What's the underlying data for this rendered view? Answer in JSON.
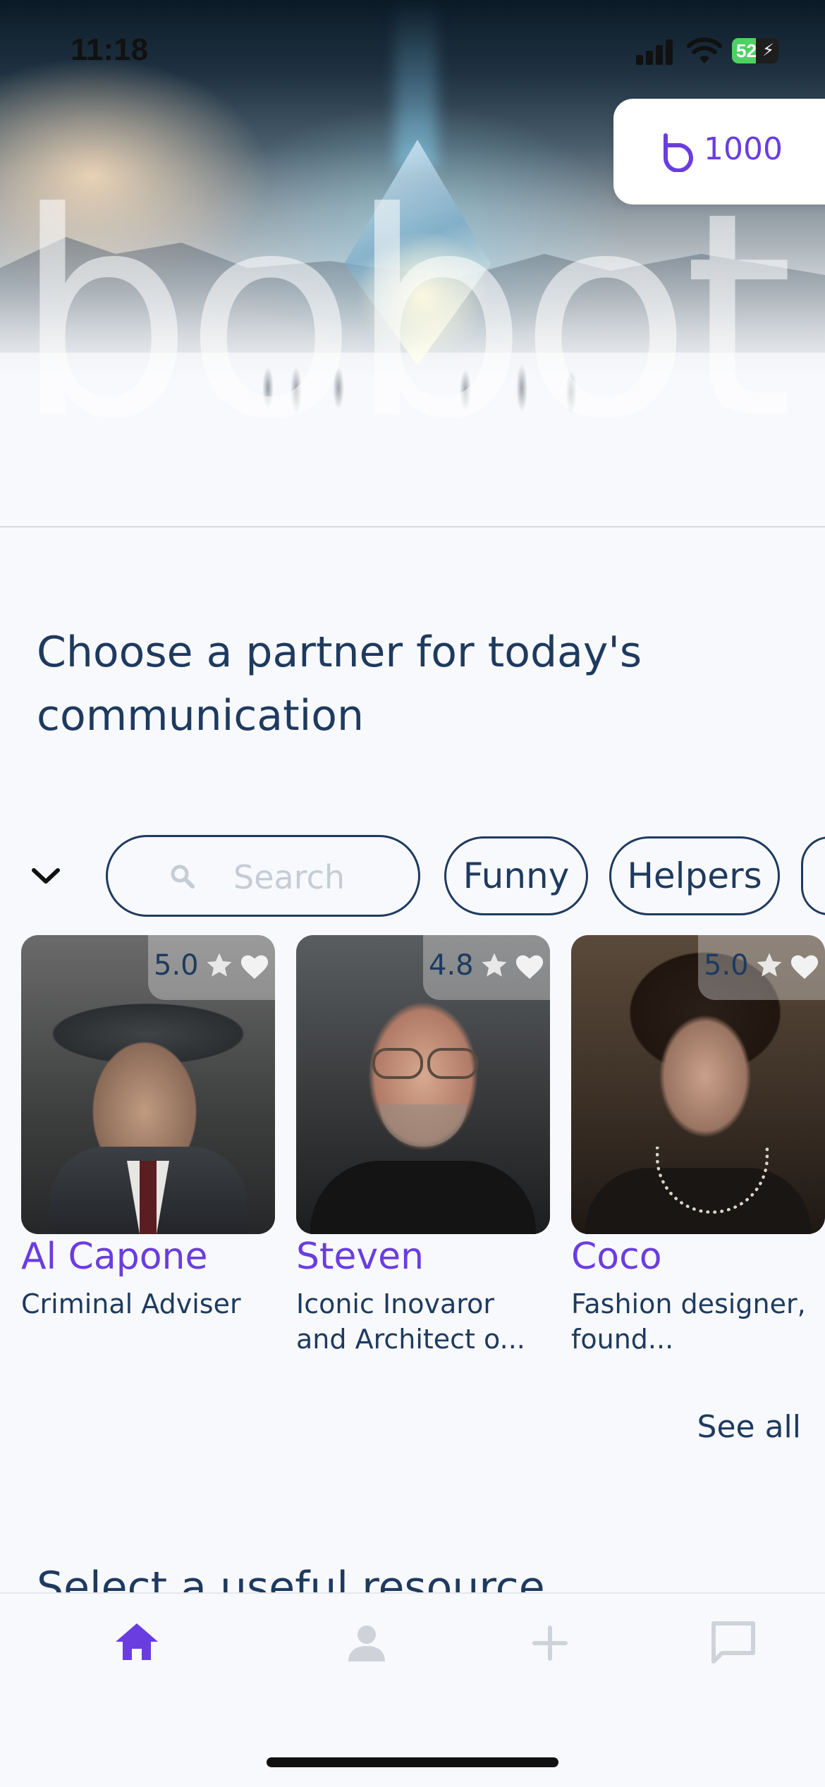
{
  "status_bar": {
    "time": "11:18",
    "battery": "52"
  },
  "hero": {
    "brand": "bobot"
  },
  "balance": {
    "value": "1000",
    "currency_icon": "coin-icon"
  },
  "headline": "Choose a partner for today's communication",
  "filters": {
    "search_placeholder": "Search",
    "chips": [
      "Funny",
      "Helpers"
    ]
  },
  "characters": [
    {
      "name": "Al Capone",
      "role": "Criminal Adviser",
      "rating": "5.0"
    },
    {
      "name": "Steven",
      "role": "Iconic Inovaror and Architect o...",
      "rating": "4.8"
    },
    {
      "name": "Coco",
      "role": "Fashion designer, found...",
      "rating": "5.0"
    }
  ],
  "see_all": "See all",
  "next_section": "Select a useful resource",
  "bottom_nav": {
    "items": [
      "home-icon",
      "profile-icon",
      "add-icon",
      "chat-icon"
    ],
    "active": "home-icon"
  },
  "colors": {
    "accent": "#6a3de0",
    "text": "#1e3a5f",
    "background": "#f8f9fc"
  }
}
